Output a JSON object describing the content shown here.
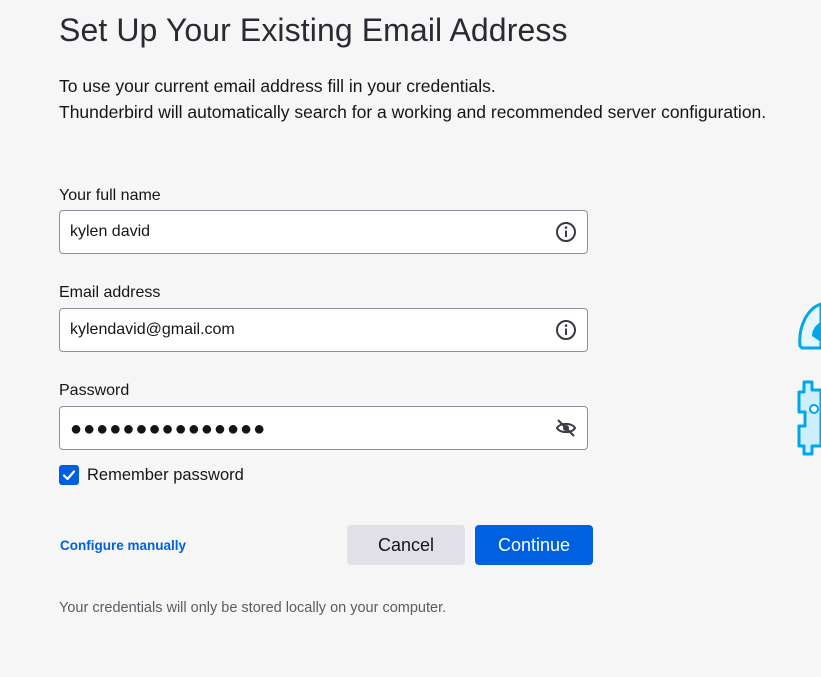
{
  "header": {
    "title": "Set Up Your Existing Email Address",
    "intro_line1": "To use your current email address fill in your credentials.",
    "intro_line2": "Thunderbird will automatically search for a working and recommended server configuration."
  },
  "form": {
    "name": {
      "label": "Your full name",
      "value": "kylen david",
      "icon": "info-icon"
    },
    "email": {
      "label": "Email address",
      "value": "kylendavid@gmail.com",
      "icon": "info-icon"
    },
    "password": {
      "label": "Password",
      "masked_value": "●●●●●●●●●●●●●●●",
      "icon": "eye-slash-icon"
    },
    "remember": {
      "label": "Remember password",
      "checked": true
    }
  },
  "actions": {
    "configure_manually": "Configure manually",
    "cancel": "Cancel",
    "continue": "Continue"
  },
  "footer": {
    "note": "Your credentials will only be stored locally on your computer."
  },
  "colors": {
    "accent": "#0061e0",
    "illustration": "#00a8e8"
  }
}
